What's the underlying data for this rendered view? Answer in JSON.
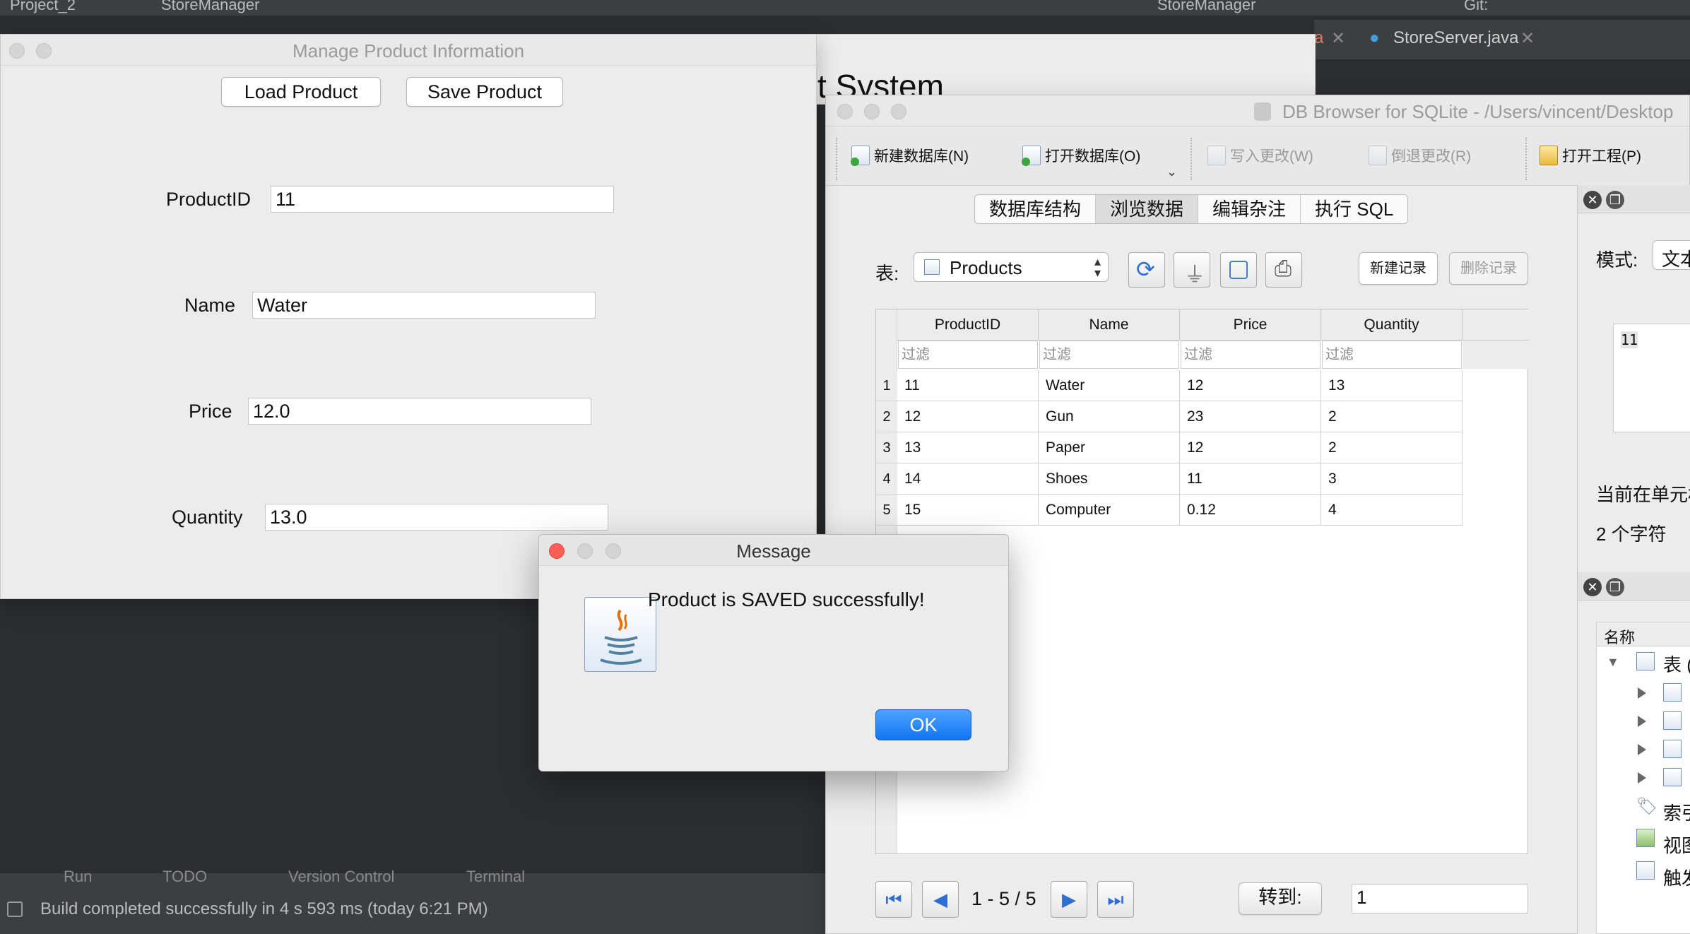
{
  "ide": {
    "project": "Project_2",
    "run_config": "StoreManager",
    "run_selector": "StoreManager",
    "vcs_label": "Git:",
    "tabs": [
      {
        "label": "a"
      },
      {
        "label": "StoreServer.java"
      }
    ],
    "bottom_tabs": [
      "Run",
      "TODO",
      "Version Control",
      "Terminal"
    ],
    "status": "Build completed successfully in 4 s 593 ms (today 6:21 PM)"
  },
  "background_window": {
    "title": "t System"
  },
  "product_window": {
    "title": "Manage Product Information",
    "load_button": "Load Product",
    "save_button": "Save Product",
    "fields": {
      "product_id": {
        "label": "ProductID",
        "value": "11"
      },
      "name": {
        "label": "Name",
        "value": "Water"
      },
      "price": {
        "label": "Price",
        "value": "12.0"
      },
      "quantity": {
        "label": "Quantity",
        "value": "13.0"
      }
    }
  },
  "db_browser": {
    "title": "DB Browser for SQLite - /Users/vincent/Desktop",
    "toolbar": {
      "new_db": "新建数据库(N)",
      "open_db": "打开数据库(O)",
      "write_changes": "写入更改(W)",
      "revert_changes": "倒退更改(R)",
      "open_project": "打开工程(P)"
    },
    "tabs": [
      "数据库结构",
      "浏览数据",
      "编辑杂注",
      "执行 SQL"
    ],
    "active_tab": 1,
    "table_label": "表:",
    "table_selected": "Products",
    "new_record": "新建记录",
    "delete_record": "删除记录",
    "columns": [
      "ProductID",
      "Name",
      "Price",
      "Quantity"
    ],
    "filter_placeholder": "过滤",
    "rows": [
      {
        "num": "1",
        "cells": [
          "11",
          "Water",
          "12",
          "13"
        ]
      },
      {
        "num": "2",
        "cells": [
          "12",
          "Gun",
          "23",
          "2"
        ]
      },
      {
        "num": "3",
        "cells": [
          "13",
          "Paper",
          "12",
          "2"
        ]
      },
      {
        "num": "4",
        "cells": [
          "14",
          "Shoes",
          "11",
          "3"
        ]
      },
      {
        "num": "5",
        "cells": [
          "15",
          "Computer",
          "0.12",
          "4"
        ]
      }
    ],
    "pagination": "1 - 5 / 5",
    "goto_label": "转到:",
    "goto_value": "1",
    "side_panel": {
      "mode_label": "模式:",
      "mode_value": "文本",
      "cell_value": "11",
      "current_cell": "当前在单元格",
      "char_count": "2 个字符",
      "name_header": "名称",
      "tree_table": "表 (",
      "tree_index": "索引",
      "tree_view": "视图",
      "tree_trigger": "触发"
    }
  },
  "message_dialog": {
    "title": "Message",
    "text": "Product is SAVED successfully!",
    "ok": "OK"
  }
}
